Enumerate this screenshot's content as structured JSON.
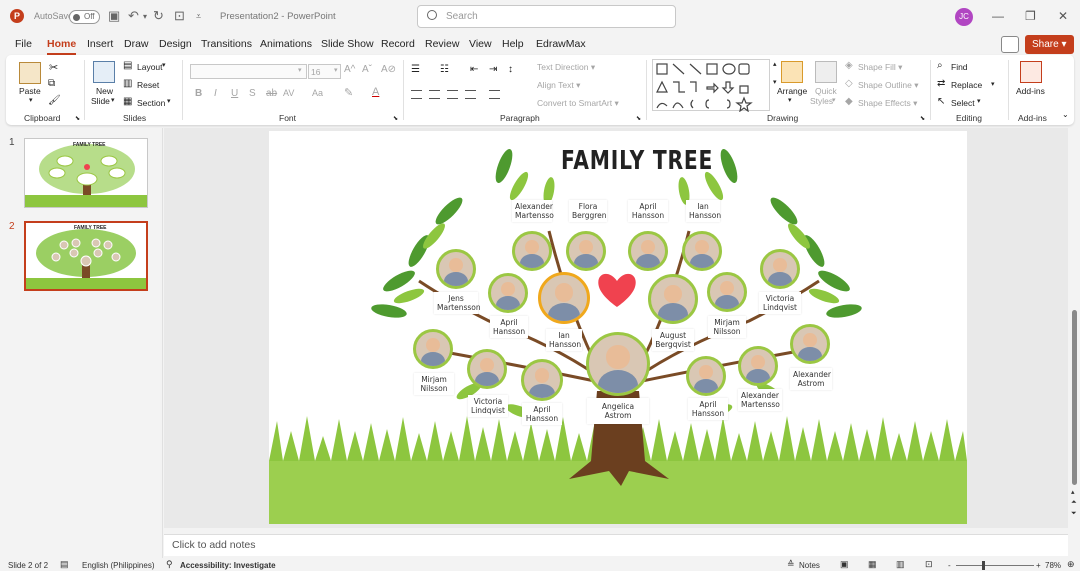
{
  "titlebar": {
    "autosave_label": "AutoSave",
    "autosave_state": "Off",
    "doc_title": "Presentation2",
    "separator": "-",
    "app_name": "PowerPoint",
    "search_placeholder": "Search",
    "user_initials": "JC"
  },
  "tabs": [
    "File",
    "Home",
    "Insert",
    "Draw",
    "Design",
    "Transitions",
    "Animations",
    "Slide Show",
    "Record",
    "Review",
    "View",
    "Help",
    "EdrawMax"
  ],
  "active_tab": "Home",
  "share_label": "Share",
  "ribbon": {
    "clipboard": {
      "label": "Clipboard",
      "paste": "Paste"
    },
    "slides": {
      "label": "Slides",
      "new_slide_1": "New",
      "new_slide_2": "Slide",
      "layout": "Layout",
      "reset": "Reset",
      "section": "Section"
    },
    "font": {
      "label": "Font",
      "size": "16",
      "bold": "B",
      "italic": "I",
      "underline": "U",
      "strike": "S",
      "spacing": "AV",
      "case": "Aa"
    },
    "paragraph": {
      "label": "Paragraph",
      "text_direction": "Text Direction",
      "align_text": "Align Text",
      "convert_smartart": "Convert to SmartArt"
    },
    "drawing": {
      "label": "Drawing",
      "arrange": "Arrange",
      "quick_styles_1": "Quick",
      "quick_styles_2": "Styles",
      "shape_fill": "Shape Fill",
      "shape_outline": "Shape Outline",
      "shape_effects": "Shape Effects"
    },
    "editing": {
      "label": "Editing",
      "find": "Find",
      "replace": "Replace",
      "select": "Select"
    },
    "addins": {
      "label": "Add-ins",
      "addins_btn": "Add-ins"
    }
  },
  "thumbnails": [
    {
      "number": "1",
      "title": "FAMILY TREE"
    },
    {
      "number": "2",
      "title": "FAMILY TREE"
    }
  ],
  "slide": {
    "title": "FAMILY TREE",
    "people": [
      {
        "name": "Alexander\nMartensso"
      },
      {
        "name": "Flora\nBerggren"
      },
      {
        "name": "April\nHansson"
      },
      {
        "name": "Ian\nHansson"
      },
      {
        "name": "Jens\nMartensson"
      },
      {
        "name": "April\nHansson"
      },
      {
        "name": "Ian\nHansson"
      },
      {
        "name": "August\nBergqvist"
      },
      {
        "name": "Mirjam\nNilsson"
      },
      {
        "name": "Victoria\nLindqvist"
      },
      {
        "name": "Mirjam\nNilsson"
      },
      {
        "name": "Victoria\nLindqvist"
      },
      {
        "name": "April\nHansson"
      },
      {
        "name": "Angelica Astrom"
      },
      {
        "name": "April\nHansson"
      },
      {
        "name": "Alexander\nMartensso"
      },
      {
        "name": "Alexander\nAstrom"
      }
    ]
  },
  "notes_placeholder": "Click to add notes",
  "status": {
    "slide_of": "Slide 2 of 2",
    "language": "English (Philippines)",
    "accessibility": "Accessibility: Investigate",
    "notes": "Notes",
    "zoom": "78%",
    "minus": "-",
    "plus": "+"
  },
  "colors": {
    "accent": "#c43e1c",
    "leaf_dark": "#3f8a2a",
    "leaf_light": "#8dc63f",
    "trunk": "#6b3f1f",
    "heart": "#f0424f"
  }
}
